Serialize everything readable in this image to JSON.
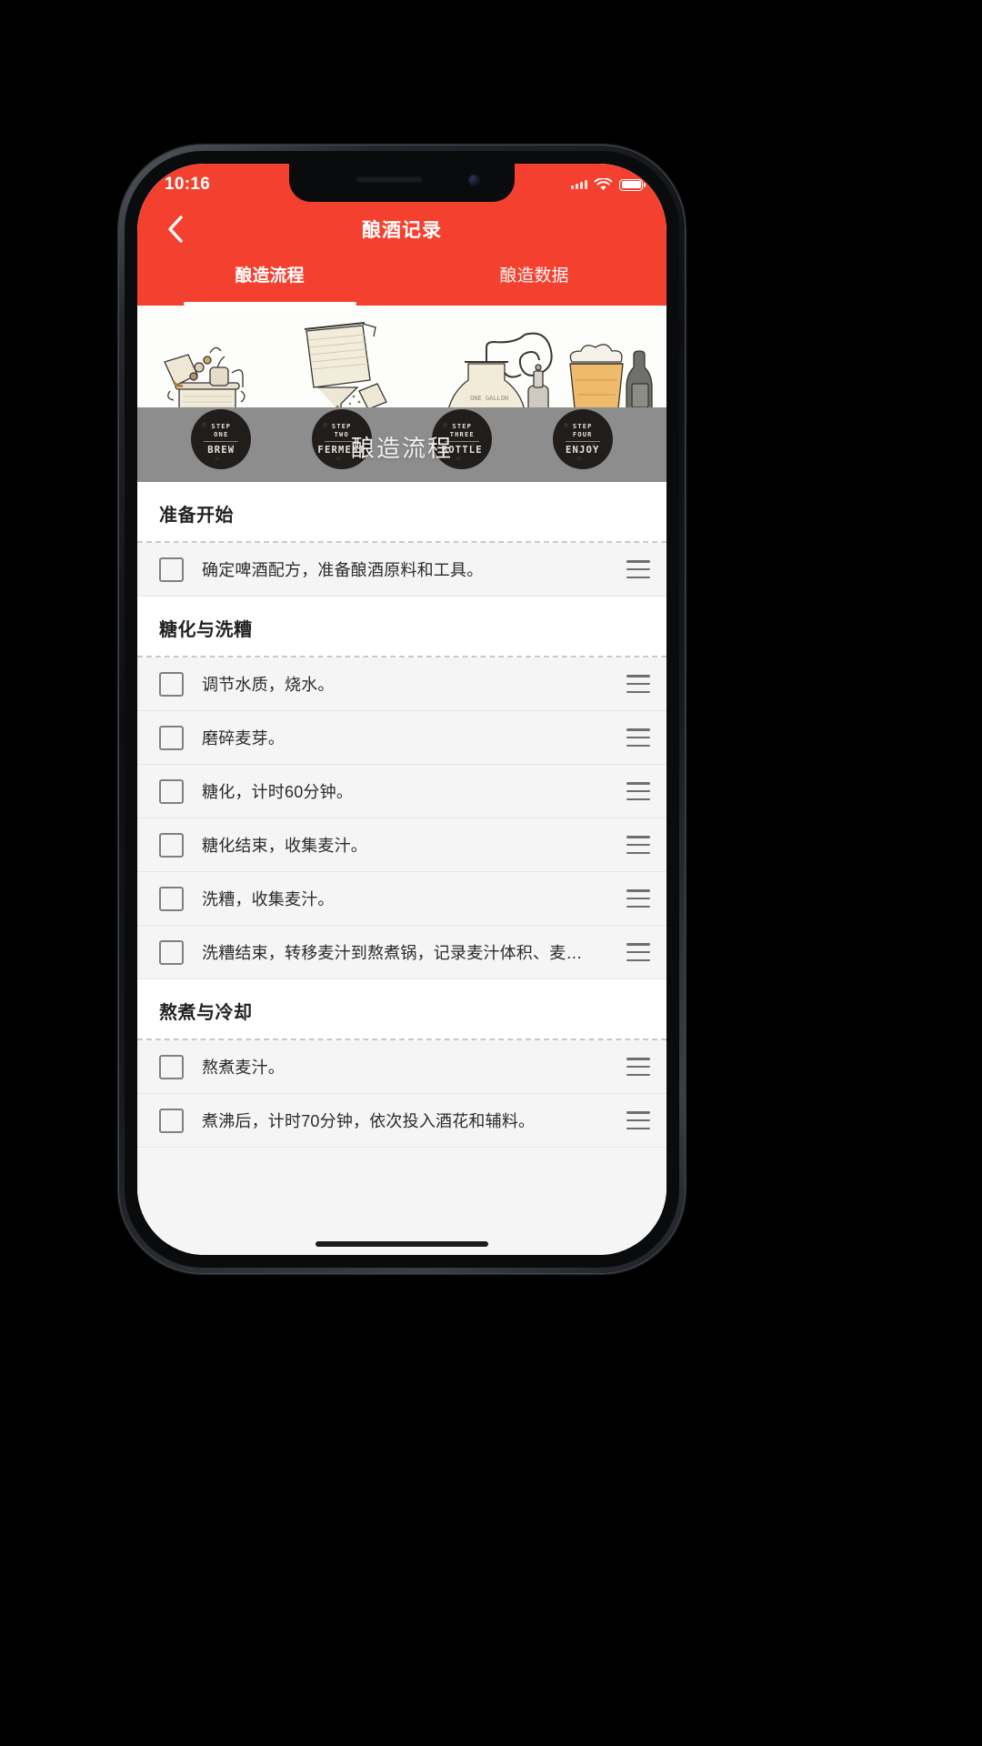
{
  "status_bar": {
    "time": "10:16",
    "wifi_icon": "wifi-icon",
    "battery_icon": "battery-icon",
    "carrier_icon": "signal-bars-icon"
  },
  "nav": {
    "back_icon": "chevron-left-icon",
    "title": "酿酒记录"
  },
  "tabs": [
    {
      "label": "酿造流程",
      "active": true
    },
    {
      "label": "酿造数据",
      "active": false
    }
  ],
  "hero": {
    "overlay_title": "酿造流程",
    "badges": [
      {
        "step": "STEP\nONE",
        "step_line1": "STEP",
        "step_line2": "ONE",
        "name": "BREW"
      },
      {
        "step": "STEP\nTWO",
        "step_line1": "STEP",
        "step_line2": "TWO",
        "name": "FERMENT"
      },
      {
        "step": "STEP\nTHREE",
        "step_line1": "STEP",
        "step_line2": "THREE",
        "name": "BOTTLE"
      },
      {
        "step": "STEP\nFOUR",
        "step_line1": "STEP",
        "step_line2": "FOUR",
        "name": "ENJOY"
      }
    ]
  },
  "sections": [
    {
      "title": "准备开始",
      "items": [
        {
          "text": "确定啤酒配方，准备酿酒原料和工具。",
          "checked": false
        }
      ]
    },
    {
      "title": "糖化与洗糟",
      "items": [
        {
          "text": "调节水质，烧水。",
          "checked": false
        },
        {
          "text": "磨碎麦芽。",
          "checked": false
        },
        {
          "text": "糖化，计时60分钟。",
          "checked": false
        },
        {
          "text": "糖化结束，收集麦汁。",
          "checked": false
        },
        {
          "text": "洗糟，收集麦汁。",
          "checked": false
        },
        {
          "text": "洗糟结束，转移麦汁到熬煮锅，记录麦汁体积、麦…",
          "checked": false
        }
      ]
    },
    {
      "title": "熬煮与冷却",
      "items": [
        {
          "text": "熬煮麦汁。",
          "checked": false
        },
        {
          "text": "煮沸后，计时70分钟，依次投入酒花和辅料。",
          "checked": false
        }
      ]
    }
  ],
  "colors": {
    "brand_red": "#f4402e",
    "list_bg": "#f5f5f5",
    "section_bg": "#ffffff",
    "text": "#2b2b2b",
    "ground": "#8d8d8d"
  },
  "icons": {
    "drag_handle": "drag-handle-icon",
    "checkbox": "checkbox-icon"
  }
}
